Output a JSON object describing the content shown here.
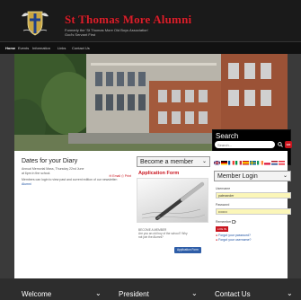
{
  "header": {
    "title": "St Thomas More Alumni",
    "tagline_line1": "Formerly the 'St Thomas More Old Boys Association'",
    "tagline_line2": "God's Servant First"
  },
  "nav": {
    "items": [
      "Home",
      "Events",
      "Information",
      "Links",
      "Contact Us"
    ]
  },
  "search": {
    "title": "Search",
    "placeholder": "Search...",
    "go_label": "GO"
  },
  "diary": {
    "title": "Dates for your Diary",
    "text_line1": "Annual Memorial Mass, Thursday 22nd June",
    "text_line2": "at 6pm in the school.",
    "text_line3": "Members can login to view past and current edition of our newsletter:",
    "newsletter_link": "Alumni",
    "email_label": "Email",
    "print_label": "Print"
  },
  "become": {
    "title": "Become a member",
    "app_form_title": "Application Form",
    "text_line1": "BECOME A MEMBER",
    "text_line2": "Are you an old boy of the school? Why not join the Alumni?",
    "button_label": "Application Form"
  },
  "login": {
    "title": "Member Login",
    "username_label": "Username",
    "username_value": "palexander",
    "password_label": "Password",
    "password_value": "••••••••",
    "remember_label": "Remember Me",
    "button_label": "LOG IN",
    "forgot_password": "Forgot your password?",
    "forgot_username": "Forgot your username?"
  },
  "footer": {
    "items": [
      "Welcome",
      "President",
      "Contact Us"
    ]
  },
  "colors": {
    "accent_red": "#c9151e",
    "link_blue": "#1a4fa0",
    "field_yellow": "#fbf6b8"
  }
}
